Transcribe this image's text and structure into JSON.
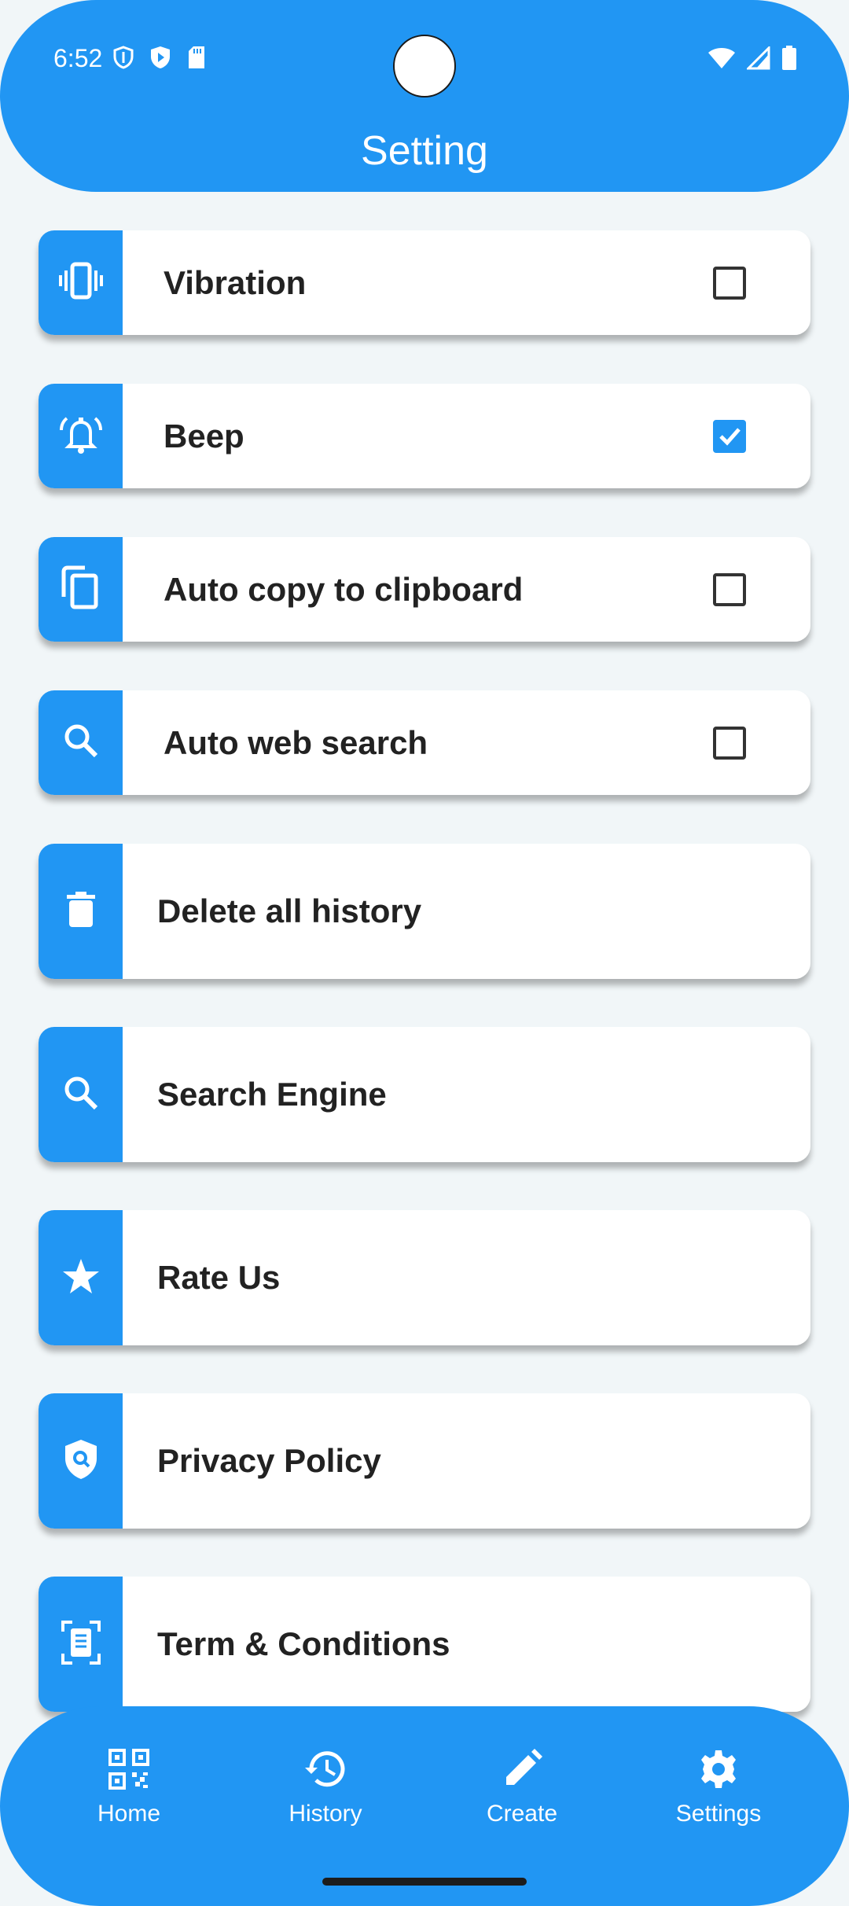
{
  "status_bar": {
    "time": "6:52",
    "left_icons": [
      "shield-outline-icon",
      "play-protect-icon",
      "sd-card-icon"
    ],
    "right_icons": [
      "wifi-icon",
      "signal-icon",
      "battery-icon"
    ]
  },
  "header": {
    "title": "Setting",
    "color": "#2196f3"
  },
  "settings": [
    {
      "label": "Vibration",
      "icon": "vibration-icon",
      "checkbox": true,
      "checked": false
    },
    {
      "label": "Beep",
      "icon": "alarm-bell-icon",
      "checkbox": true,
      "checked": true
    },
    {
      "label": "Auto copy to clipboard",
      "icon": "copy-icon",
      "checkbox": true,
      "checked": false
    },
    {
      "label": "Auto web search",
      "icon": "search-icon",
      "checkbox": true,
      "checked": false
    },
    {
      "label": "Delete all history",
      "icon": "trash-icon",
      "checkbox": false
    },
    {
      "label": "Search Engine",
      "icon": "search-icon",
      "checkbox": false
    },
    {
      "label": "Rate Us",
      "icon": "star-icon",
      "checkbox": false
    },
    {
      "label": "Privacy Policy",
      "icon": "privacy-shield-icon",
      "checkbox": false
    },
    {
      "label": "Term & Conditions",
      "icon": "document-scan-icon",
      "checkbox": false
    }
  ],
  "bottom_nav": {
    "items": [
      {
        "label": "Home",
        "icon": "qr-code-icon"
      },
      {
        "label": "History",
        "icon": "history-icon"
      },
      {
        "label": "Create",
        "icon": "pencil-icon"
      },
      {
        "label": "Settings",
        "icon": "gear-icon"
      }
    ]
  }
}
